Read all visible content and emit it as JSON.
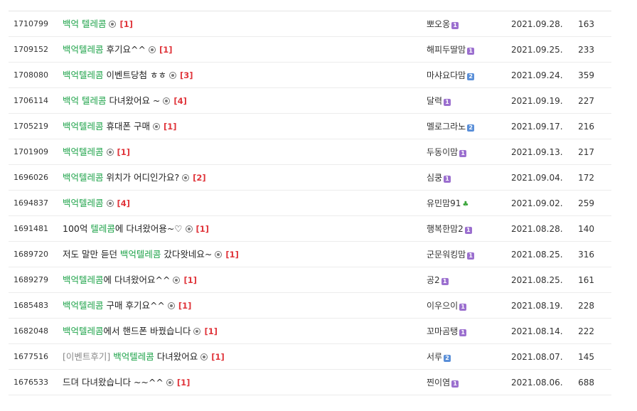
{
  "posts": [
    {
      "num": "1710799",
      "prefix": "",
      "parts": [
        {
          "k": true,
          "t": "백억 텔레콤"
        }
      ],
      "count": "[1]",
      "author": "뽀오옹",
      "level": "1",
      "level_color": "purple",
      "date": "2021.09.28.",
      "views": "163"
    },
    {
      "num": "1709152",
      "prefix": "",
      "parts": [
        {
          "k": true,
          "t": "백억텔레콤"
        },
        {
          "k": false,
          "t": " 후기요^^"
        }
      ],
      "count": "[1]",
      "author": "해피두딸맘",
      "level": "1",
      "level_color": "purple",
      "date": "2021.09.25.",
      "views": "233"
    },
    {
      "num": "1708080",
      "prefix": "",
      "parts": [
        {
          "k": true,
          "t": "백억텔레콤"
        },
        {
          "k": false,
          "t": " 이벤트당첨 ㅎㅎ"
        }
      ],
      "count": "[3]",
      "author": "마샤요다맘",
      "level": "2",
      "level_color": "blue",
      "date": "2021.09.24.",
      "views": "359"
    },
    {
      "num": "1706114",
      "prefix": "",
      "parts": [
        {
          "k": true,
          "t": "백억 텔레콤"
        },
        {
          "k": false,
          "t": " 다녀왔어요 ~"
        }
      ],
      "count": "[4]",
      "author": "달력",
      "level": "1",
      "level_color": "purple",
      "date": "2021.09.19.",
      "views": "227"
    },
    {
      "num": "1705219",
      "prefix": "",
      "parts": [
        {
          "k": true,
          "t": "백억텔레콤"
        },
        {
          "k": false,
          "t": " 휴대폰 구매"
        }
      ],
      "count": "[1]",
      "author": "멜로그라노",
      "level": "2",
      "level_color": "blue",
      "date": "2021.09.17.",
      "views": "216"
    },
    {
      "num": "1701909",
      "prefix": "",
      "parts": [
        {
          "k": true,
          "t": "백억텔레콤"
        }
      ],
      "count": "[1]",
      "author": "두동이맘",
      "level": "1",
      "level_color": "purple",
      "date": "2021.09.13.",
      "views": "217"
    },
    {
      "num": "1696026",
      "prefix": "",
      "parts": [
        {
          "k": true,
          "t": "백억텔레콤"
        },
        {
          "k": false,
          "t": " 위치가 어디인가요?"
        }
      ],
      "count": "[2]",
      "author": "심쿵",
      "level": "1",
      "level_color": "purple",
      "date": "2021.09.04.",
      "views": "172"
    },
    {
      "num": "1694837",
      "prefix": "",
      "parts": [
        {
          "k": true,
          "t": "백억텔레콤"
        }
      ],
      "count": "[4]",
      "author": "유민맘91",
      "level": "♣",
      "level_color": "leaf",
      "date": "2021.09.02.",
      "views": "259"
    },
    {
      "num": "1691481",
      "prefix": "",
      "parts": [
        {
          "k": false,
          "t": "100억 "
        },
        {
          "k": true,
          "t": "텔레콤"
        },
        {
          "k": false,
          "t": "에 다녀왔어용~♡"
        }
      ],
      "count": "[1]",
      "author": "행복한맘2",
      "level": "1",
      "level_color": "purple",
      "date": "2021.08.28.",
      "views": "140"
    },
    {
      "num": "1689720",
      "prefix": "",
      "parts": [
        {
          "k": false,
          "t": "저도 말만 듣던 "
        },
        {
          "k": true,
          "t": "백억텔레콤"
        },
        {
          "k": false,
          "t": " 갔다왓네요~"
        }
      ],
      "count": "[1]",
      "author": "군문워킹맘",
      "level": "1",
      "level_color": "purple",
      "date": "2021.08.25.",
      "views": "316"
    },
    {
      "num": "1689279",
      "prefix": "",
      "parts": [
        {
          "k": true,
          "t": "백억텔레콤"
        },
        {
          "k": false,
          "t": "에 다녀왔어요^^"
        }
      ],
      "count": "[1]",
      "author": "공2",
      "level": "1",
      "level_color": "purple",
      "date": "2021.08.25.",
      "views": "161"
    },
    {
      "num": "1685483",
      "prefix": "",
      "parts": [
        {
          "k": true,
          "t": "백억텔레콤"
        },
        {
          "k": false,
          "t": " 구매 후기요^^"
        }
      ],
      "count": "[1]",
      "author": "이우으이",
      "level": "1",
      "level_color": "purple",
      "date": "2021.08.19.",
      "views": "228"
    },
    {
      "num": "1682048",
      "prefix": "",
      "parts": [
        {
          "k": true,
          "t": "백억텔레콤"
        },
        {
          "k": false,
          "t": "에서 핸드폰 바꿨습니다"
        }
      ],
      "count": "[1]",
      "author": "꼬마곰탱",
      "level": "1",
      "level_color": "purple",
      "date": "2021.08.14.",
      "views": "222"
    },
    {
      "num": "1677516",
      "prefix": "[이벤트후기]",
      "parts": [
        {
          "k": true,
          "t": "백억텔레콤"
        },
        {
          "k": false,
          "t": " 다녀왔어요"
        }
      ],
      "count": "[1]",
      "author": "서루",
      "level": "2",
      "level_color": "blue",
      "date": "2021.08.07.",
      "views": "145"
    },
    {
      "num": "1676533",
      "prefix": "",
      "parts": [
        {
          "k": false,
          "t": "드뎌 다녀왔습니다 ~~^^"
        }
      ],
      "count": "[1]",
      "author": "찐이염",
      "level": "1",
      "level_color": "purple",
      "date": "2021.08.06.",
      "views": "688"
    }
  ]
}
